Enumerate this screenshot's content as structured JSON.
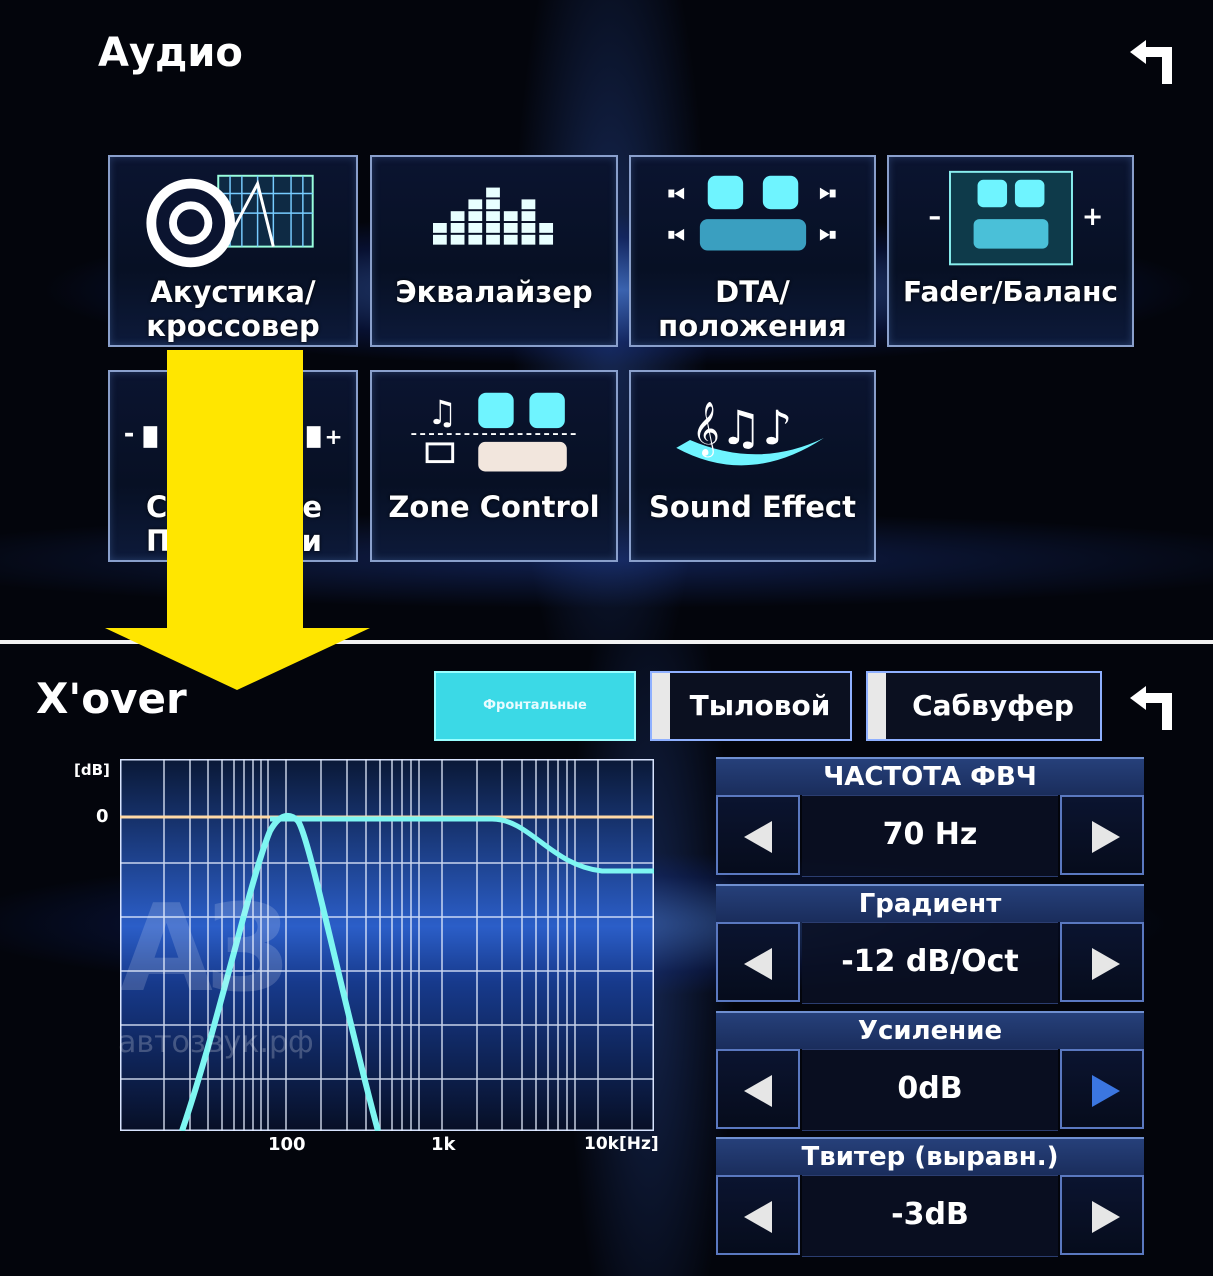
{
  "audio_menu": {
    "title": "Аудио",
    "back_icon": "return-arrow-icon",
    "tiles": [
      {
        "label_line1": "Акустика/",
        "label_line2": "кроссовер",
        "icon": "speaker-crossover-icon"
      },
      {
        "label_line1": "Эквалайзер",
        "label_line2": "",
        "icon": "equalizer-bars-icon"
      },
      {
        "label_line1": "DTA/",
        "label_line2": "положения",
        "icon": "seat-position-icon"
      },
      {
        "label_line1": "Fader/Баланс",
        "label_line2": "",
        "icon": "fader-balance-icon"
      },
      {
        "label_line1": "C",
        "label_line2": "П",
        "label_line1_end": "e",
        "label_line2_end": "и",
        "icon": "volume-offset-icon"
      },
      {
        "label_line1": "Zone Control",
        "label_line2": "",
        "icon": "zone-control-icon"
      },
      {
        "label_line1": "Sound Effect",
        "label_line2": "",
        "icon": "sound-effect-icon"
      }
    ]
  },
  "xover": {
    "title": "X'over",
    "back_icon": "return-arrow-icon",
    "tabs": [
      {
        "label": "Фронтальные",
        "active": true
      },
      {
        "label": "Тыловой",
        "active": false
      },
      {
        "label": "Сабвуфер",
        "active": false
      }
    ],
    "graph": {
      "y_unit": "[dB]",
      "y_zero": "0",
      "x_ticks": [
        "100",
        "1k",
        "10k[Hz]"
      ],
      "watermark_logo": "АЗ",
      "watermark_text": "автозвук.рф"
    },
    "controls": [
      {
        "title": "ЧАСТОТА ФВЧ",
        "value": "70 Hz",
        "right_enabled": true
      },
      {
        "title": "Градиент",
        "value": "-12 dB/Oct",
        "right_enabled": true
      },
      {
        "title": "Усиление",
        "value": "0dB",
        "right_enabled": false
      },
      {
        "title": "Твитер (выравн.)",
        "value": "-3dB",
        "right_enabled": true
      }
    ]
  },
  "colors": {
    "accent_cyan": "#3bd9e6",
    "annotation_arrow": "#ffe600",
    "frame_blue": "#8fb0ff"
  }
}
